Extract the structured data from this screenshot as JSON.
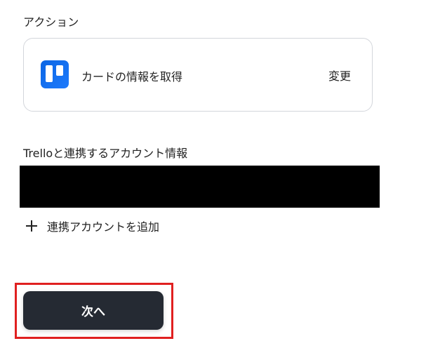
{
  "action_section": {
    "title": "アクション",
    "card": {
      "icon": "trello-icon",
      "label": "カードの情報を取得",
      "change_label": "変更"
    }
  },
  "account_section": {
    "title": "Trelloと連携するアカウント情報",
    "add_account_icon": "plus-icon",
    "add_account_label": "連携アカウントを追加"
  },
  "footer": {
    "next_label": "次へ"
  },
  "colors": {
    "trello_blue": "#0c66e4",
    "next_button_bg": "#252a33",
    "highlight_border": "#e02020",
    "card_border": "#d3d6db"
  }
}
